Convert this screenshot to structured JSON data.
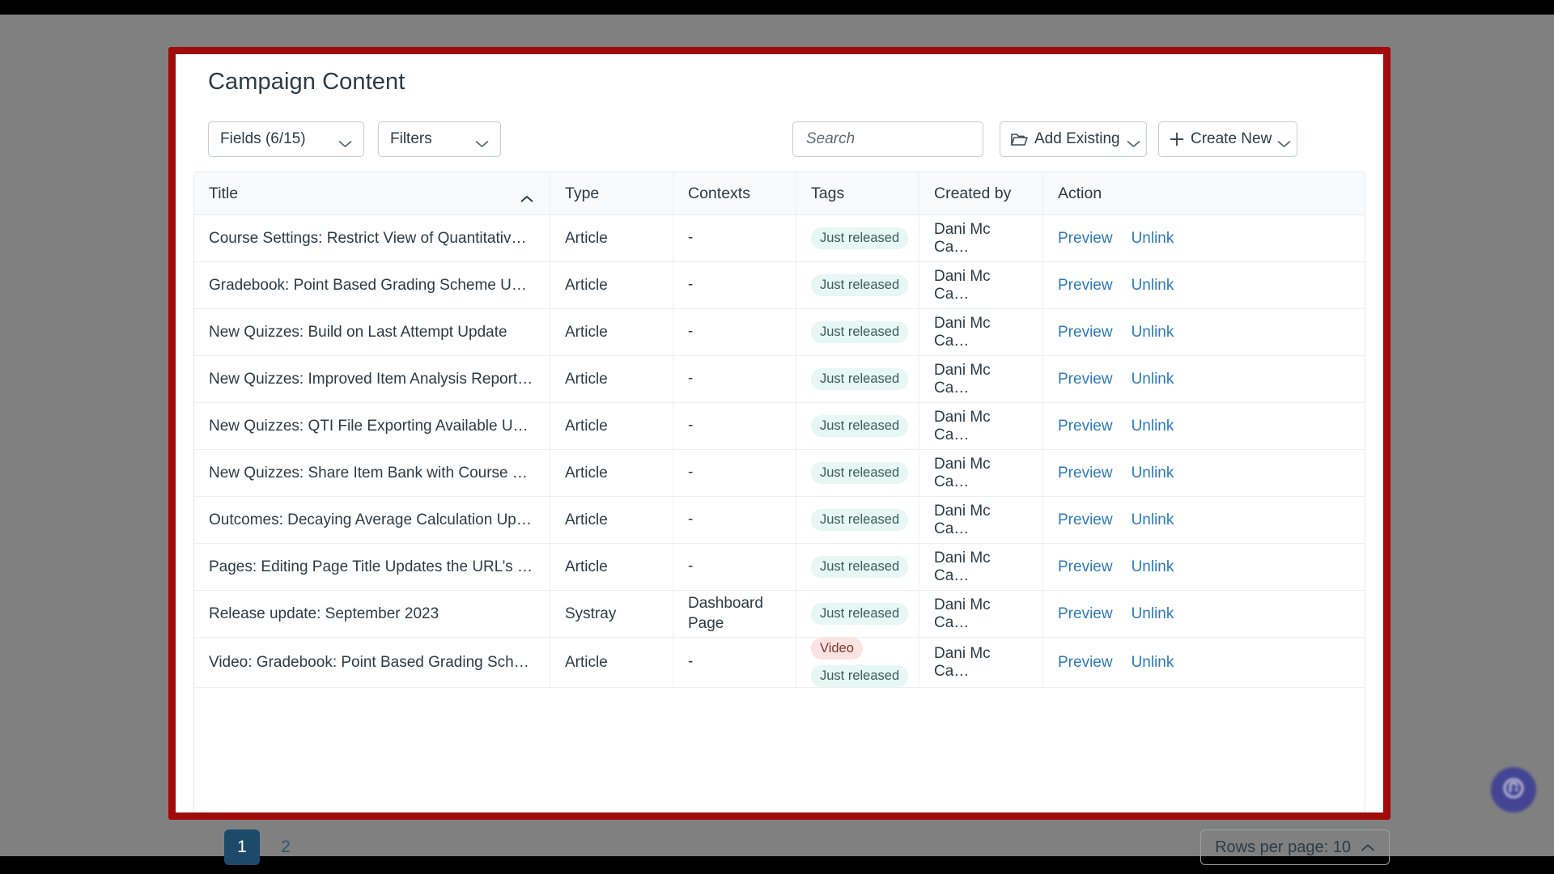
{
  "page": {
    "title": "Campaign Content"
  },
  "toolbar": {
    "fields_label": "Fields (6/15)",
    "filters_label": "Filters",
    "search_placeholder": "Search",
    "search_value": "",
    "search_icon": "search-icon",
    "add_existing_label": "Add Existing",
    "add_existing_icon": "folder-icon",
    "create_new_label": "Create New",
    "create_new_icon": "plus-icon",
    "chevron_icon": "chevron-down-icon"
  },
  "table": {
    "columns": [
      "Title",
      "Type",
      "Contexts",
      "Tags",
      "Created by",
      "Action"
    ],
    "sort": {
      "column": "Title",
      "direction": "asc",
      "icon": "chevron-up-icon"
    },
    "actions": {
      "preview": "Preview",
      "unlink": "Unlink"
    },
    "rows": [
      {
        "title": "Course Settings: Restrict View of Quantitative D…",
        "type": "Article",
        "contexts": "-",
        "tags": [
          {
            "label": "Just released",
            "style": "released"
          }
        ],
        "created_by": "Dani Mc Ca…"
      },
      {
        "title": "Gradebook: Point Based Grading Scheme Update",
        "type": "Article",
        "contexts": "-",
        "tags": [
          {
            "label": "Just released",
            "style": "released"
          }
        ],
        "created_by": "Dani Mc Ca…"
      },
      {
        "title": "New Quizzes: Build on Last Attempt Update",
        "type": "Article",
        "contexts": "-",
        "tags": [
          {
            "label": "Just released",
            "style": "released"
          }
        ],
        "created_by": "Dani Mc Ca…"
      },
      {
        "title": "New Quizzes: Improved Item Analysis Report U…",
        "type": "Article",
        "contexts": "-",
        "tags": [
          {
            "label": "Just released",
            "style": "released"
          }
        ],
        "created_by": "Dani Mc Ca…"
      },
      {
        "title": "New Quizzes: QTI File Exporting Available Update",
        "type": "Article",
        "contexts": "-",
        "tags": [
          {
            "label": "Just released",
            "style": "released"
          }
        ],
        "created_by": "Dani Mc Ca…"
      },
      {
        "title": "New Quizzes: Share Item Bank with Course Ch…",
        "type": "Article",
        "contexts": "-",
        "tags": [
          {
            "label": "Just released",
            "style": "released"
          }
        ],
        "created_by": "Dani Mc Ca…"
      },
      {
        "title": "Outcomes: Decaying Average Calculation Update",
        "type": "Article",
        "contexts": "-",
        "tags": [
          {
            "label": "Just released",
            "style": "released"
          }
        ],
        "created_by": "Dani Mc Ca…"
      },
      {
        "title": "Pages: Editing Page Title Updates the URL’s Up…",
        "type": "Article",
        "contexts": "-",
        "tags": [
          {
            "label": "Just released",
            "style": "released"
          }
        ],
        "created_by": "Dani Mc Ca…"
      },
      {
        "title": "Release update: September 2023",
        "type": "Systray",
        "contexts": "Dashboard Page",
        "tags": [
          {
            "label": "Just released",
            "style": "released"
          }
        ],
        "created_by": "Dani Mc Ca…"
      },
      {
        "title": "Video: Gradebook: Point Based Grading Schem…",
        "type": "Article",
        "contexts": "-",
        "tags": [
          {
            "label": "Video",
            "style": "video"
          },
          {
            "label": "Just released",
            "style": "released"
          }
        ],
        "created_by": "Dani Mc Ca…"
      }
    ]
  },
  "footer": {
    "pages": [
      {
        "label": "1",
        "active": true
      },
      {
        "label": "2",
        "active": false
      }
    ],
    "rows_per_page_label": "Rows per page: 10",
    "rows_per_page_icon": "chevron-up-icon"
  },
  "fab": {
    "icon": "help-chat-icon"
  },
  "colors": {
    "highlight_border": "#a20b0b",
    "desktop": "#808080",
    "text": "#2d3b45",
    "link": "#2b7abc",
    "tag_released_bg": "#e6f7f4",
    "tag_released_fg": "#3c5d5c",
    "tag_video_bg": "#fbe3e1",
    "tag_video_fg": "#7c3632",
    "page_active_bg": "#1d4a6b",
    "fab_bg": "#3f4196"
  }
}
